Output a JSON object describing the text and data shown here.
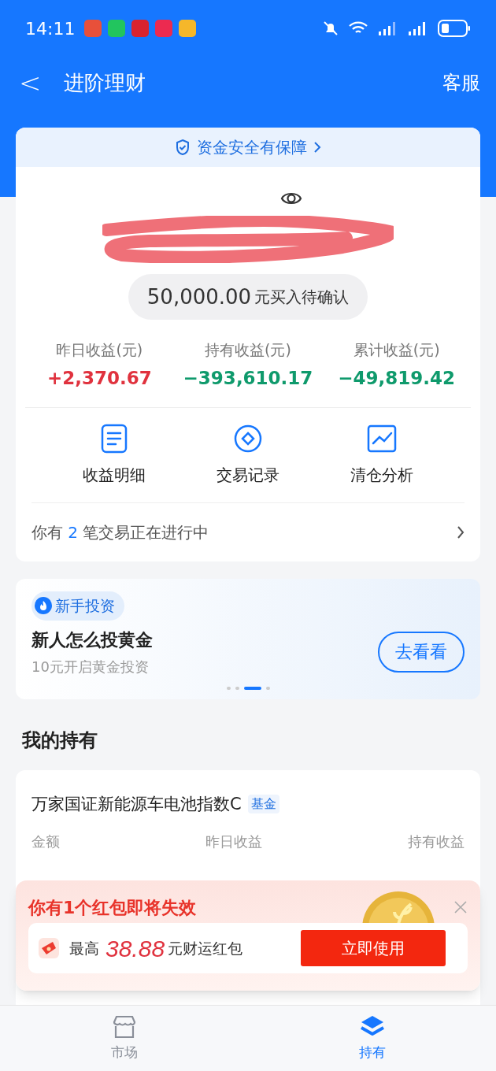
{
  "status_bar": {
    "time": "14:11"
  },
  "nav": {
    "back": "<",
    "title": "进阶理财",
    "action": "客服"
  },
  "summary": {
    "safety": "资金安全有保障",
    "pending_amount": "50,000.00",
    "pending_text": "元买入待确认",
    "stats": [
      {
        "label": "昨日收益(元)",
        "value": "+2,370.67",
        "color": "#e0323e"
      },
      {
        "label": "持有收益(元)",
        "value": "−393,610.17",
        "color": "#0f9a6c"
      },
      {
        "label": "累计收益(元)",
        "value": "−49,819.42",
        "color": "#0f9a6c"
      }
    ],
    "actions": [
      {
        "label": "收益明细",
        "kind": "document"
      },
      {
        "label": "交易记录",
        "kind": "record"
      },
      {
        "label": "清仓分析",
        "kind": "chart"
      }
    ],
    "notice": {
      "before": "你有",
      "count": "2",
      "after": "笔交易正在进行中"
    }
  },
  "promo": {
    "tag": "新手投资",
    "title": "新人怎么投黄金",
    "subtitle": "10元开启黄金投资",
    "button": "去看看",
    "dots": [
      {
        "selected": false
      },
      {
        "selected": false
      },
      {
        "selected": true
      },
      {
        "selected": false
      }
    ]
  },
  "holdings": {
    "title": "我的持有",
    "funds": [
      {
        "name": "万家国证新能源车电池指数C",
        "tag": "基金"
      }
    ],
    "columns": [
      "金额",
      "昨日收益",
      "持有收益"
    ]
  },
  "popup": {
    "title": "你有1个红包即将失效",
    "prefix": "最高",
    "amount": "38.88",
    "suffix": "元财运红包",
    "button": "立即使用"
  },
  "tabs": [
    {
      "label": "市场",
      "kind": "store",
      "selected": false
    },
    {
      "label": "持有",
      "kind": "layers",
      "selected": true
    }
  ]
}
